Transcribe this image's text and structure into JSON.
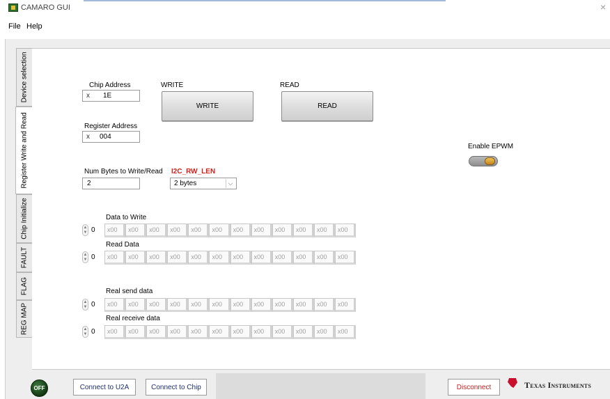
{
  "window": {
    "title": "CAMARO GUI",
    "close_symbol": "×"
  },
  "menu": [
    "File",
    "Help"
  ],
  "tabs": [
    "Device selection",
    "Register Write and Read",
    "Chip Initialize",
    "FAULT",
    "FLAG",
    "REG MAP"
  ],
  "active_tab": "Register Write and Read",
  "chip_address": {
    "label": "Chip Address",
    "prefix": "x",
    "value": "1E"
  },
  "register_address": {
    "label": "Register Address",
    "prefix": "x",
    "value": "004"
  },
  "write": {
    "label": "WRITE",
    "button": "WRITE"
  },
  "read": {
    "label": "READ",
    "button": "READ"
  },
  "num_bytes": {
    "label": "Num Bytes to Write/Read",
    "value": "2"
  },
  "rw_len": {
    "label": "I2C_RW_LEN",
    "selected": "2 bytes",
    "arrow": "⌵"
  },
  "epwm": {
    "label": "Enable EPWM",
    "on": true
  },
  "arrays": {
    "index": "0",
    "spinner_up": "▲",
    "spinner_down": "▼",
    "data_to_write": {
      "label": "Data to Write",
      "cells": [
        "x00",
        "x00",
        "x00",
        "x00",
        "x00",
        "x00",
        "x00",
        "x00",
        "x00",
        "x00",
        "x00",
        "x00"
      ]
    },
    "read_data": {
      "label": "Read Data",
      "cells": [
        "x00",
        "x00",
        "x00",
        "x00",
        "x00",
        "x00",
        "x00",
        "x00",
        "x00",
        "x00",
        "x00",
        "x00"
      ]
    },
    "real_send_data": {
      "label": "Real send data",
      "cells": [
        "x00",
        "x00",
        "x00",
        "x00",
        "x00",
        "x00",
        "x00",
        "x00",
        "x00",
        "x00",
        "x00",
        "x00"
      ]
    },
    "real_receive_data": {
      "label": "Real receive data",
      "cells": [
        "x00",
        "x00",
        "x00",
        "x00",
        "x00",
        "x00",
        "x00",
        "x00",
        "x00",
        "x00",
        "x00",
        "x00"
      ]
    }
  },
  "bottom": {
    "led": "OFF",
    "connect_u2a": "Connect to U2A",
    "connect_chip": "Connect to Chip",
    "disconnect": "Disconnect",
    "brand": "Texas Instruments"
  },
  "colors": {
    "accent_red": "#d0201a",
    "ti_red": "#c8102e",
    "led_green": "#1f5a1f",
    "knob_orange": "#d89a2a"
  }
}
